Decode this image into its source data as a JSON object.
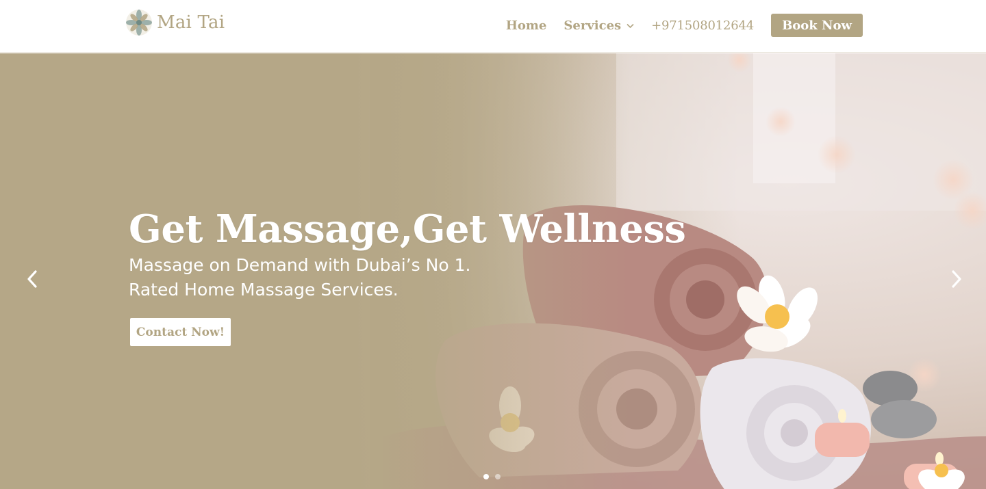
{
  "brand": {
    "name": "Mai Tai",
    "logo_icon": "lotus-mandala-icon"
  },
  "nav": {
    "items": [
      {
        "label": "Home"
      },
      {
        "label": "Services",
        "has_dropdown": true
      },
      {
        "label": "+971508012644"
      }
    ],
    "cta_label": "Book Now"
  },
  "hero": {
    "title": "Get Massage,Get Wellness",
    "subtitle_line1": "Massage on Demand with Dubai’s No 1.",
    "subtitle_line2": "Rated Home Massage Services.",
    "button_label": "Contact Now!",
    "prev_icon": "chevron-left-icon",
    "next_icon": "chevron-right-icon",
    "slides_total": 2,
    "active_slide": 1
  },
  "colors": {
    "accent": "#b2a583",
    "overlay": "#b5a787",
    "white": "#ffffff"
  }
}
